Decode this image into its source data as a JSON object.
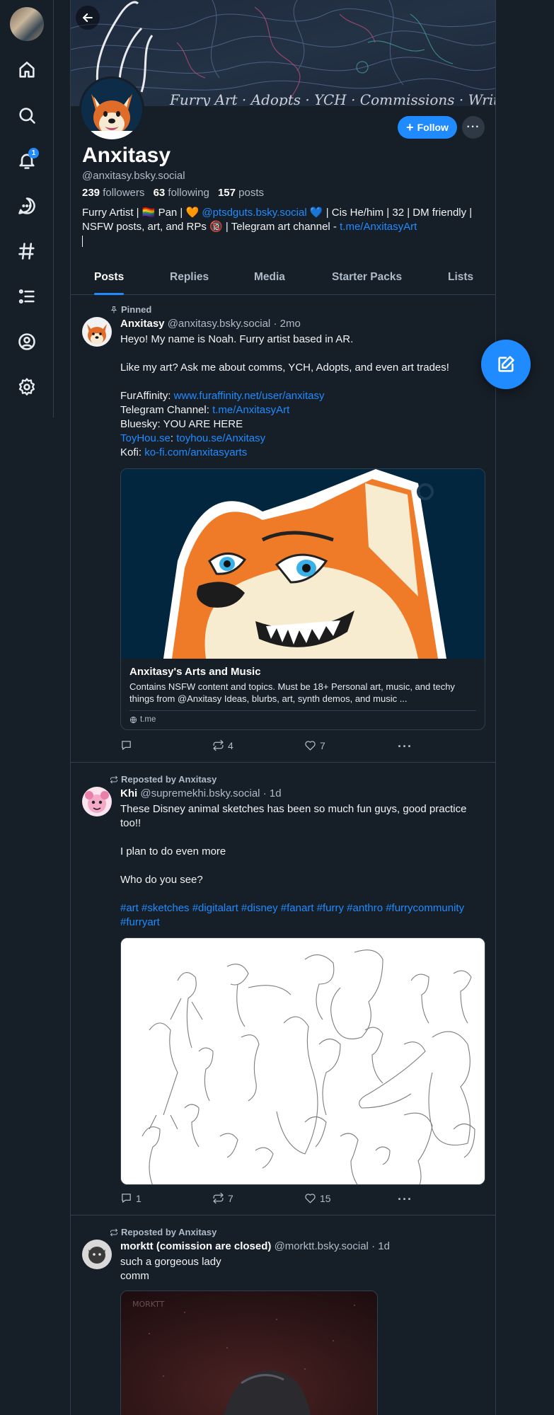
{
  "nav": {
    "notifications_badge": "1",
    "icons": [
      "home-icon",
      "search-icon",
      "bell-icon",
      "chat-icon",
      "hashtag-icon",
      "list-icon",
      "profile-icon",
      "gear-icon"
    ]
  },
  "profile": {
    "display_name": "Anxitasy",
    "handle": "@anxitasy.bsky.social",
    "followers_count": "239",
    "followers_label": "followers",
    "following_count": "63",
    "following_label": "following",
    "posts_count": "157",
    "posts_label": "posts",
    "follow_label": "Follow",
    "more_label": "···",
    "bio": {
      "part1": "Furry Artist | 🏳️‍🌈 Pan | 🧡 ",
      "mention": "@ptsdguts.bsky.social",
      "part2": " 💙 | Cis He/him | 32 | DM friendly | NSFW posts, art, and RPs 🔞 | Telegram art channel - ",
      "link": "t.me/AnxitasyArt"
    }
  },
  "tabs": [
    {
      "label": "Posts",
      "active": true
    },
    {
      "label": "Replies"
    },
    {
      "label": "Media"
    },
    {
      "label": "Starter Packs"
    },
    {
      "label": "Lists"
    }
  ],
  "posts": [
    {
      "context": "Pinned",
      "author_name": "Anxitasy",
      "author_handle": "@anxitasy.bsky.social",
      "time": "· 2mo",
      "text_intro": "Heyo! My name is Noah. Furry artist based in AR.\n\nLike my art? Ask me about comms, YCH, Adopts, and even art trades!\n",
      "fa_label": "FurAffinity: ",
      "fa_link": "www.furaffinity.net/user/anxitasy",
      "tg_label": "Telegram Channel: ",
      "tg_link": "t.me/AnxitasyArt",
      "bsky_line": "Bluesky: YOU ARE HERE",
      "toyhou_link1": "ToyHou.se",
      "toyhou_sep": ": ",
      "toyhou_link2": "toyhou.se/Anxitasy",
      "kofi_label": "Kofi: ",
      "kofi_link": "ko-fi.com/anxitasyarts",
      "embed": {
        "title": "Anxitasy's Arts and Music",
        "description": "Contains NSFW content and topics. Must be 18+              Personal art, music, and techy things from @Anxitasy Ideas, blurbs, art, synth demos, and music ...",
        "domain": "t.me"
      },
      "replies": "",
      "reposts": "4",
      "likes": "7"
    },
    {
      "context": "Reposted by Anxitasy",
      "author_name": "Khi",
      "author_handle": "@supremekhi.bsky.social",
      "time": "· 1d",
      "text": "These Disney animal sketches has been so much fun guys, good practice too!!\n\nI plan to do even more\n\nWho do you see?\n",
      "hashtags": "#art #sketches #digitalart #disney #fanart #furry #anthro #furrycommunity #furryart",
      "replies": "1",
      "reposts": "7",
      "likes": "15"
    },
    {
      "context": "Reposted by Anxitasy",
      "author_name": "morktt (comission are closed)",
      "author_handle": "@morktt.bsky.social",
      "time": "· 1d",
      "text": "such a gorgeous lady\ncomm",
      "image_watermark": "MORKTT"
    }
  ],
  "colors": {
    "background": "#161e27",
    "accent": "#208bfe",
    "border": "#2e4052",
    "muted_text": "#aebbc9"
  }
}
